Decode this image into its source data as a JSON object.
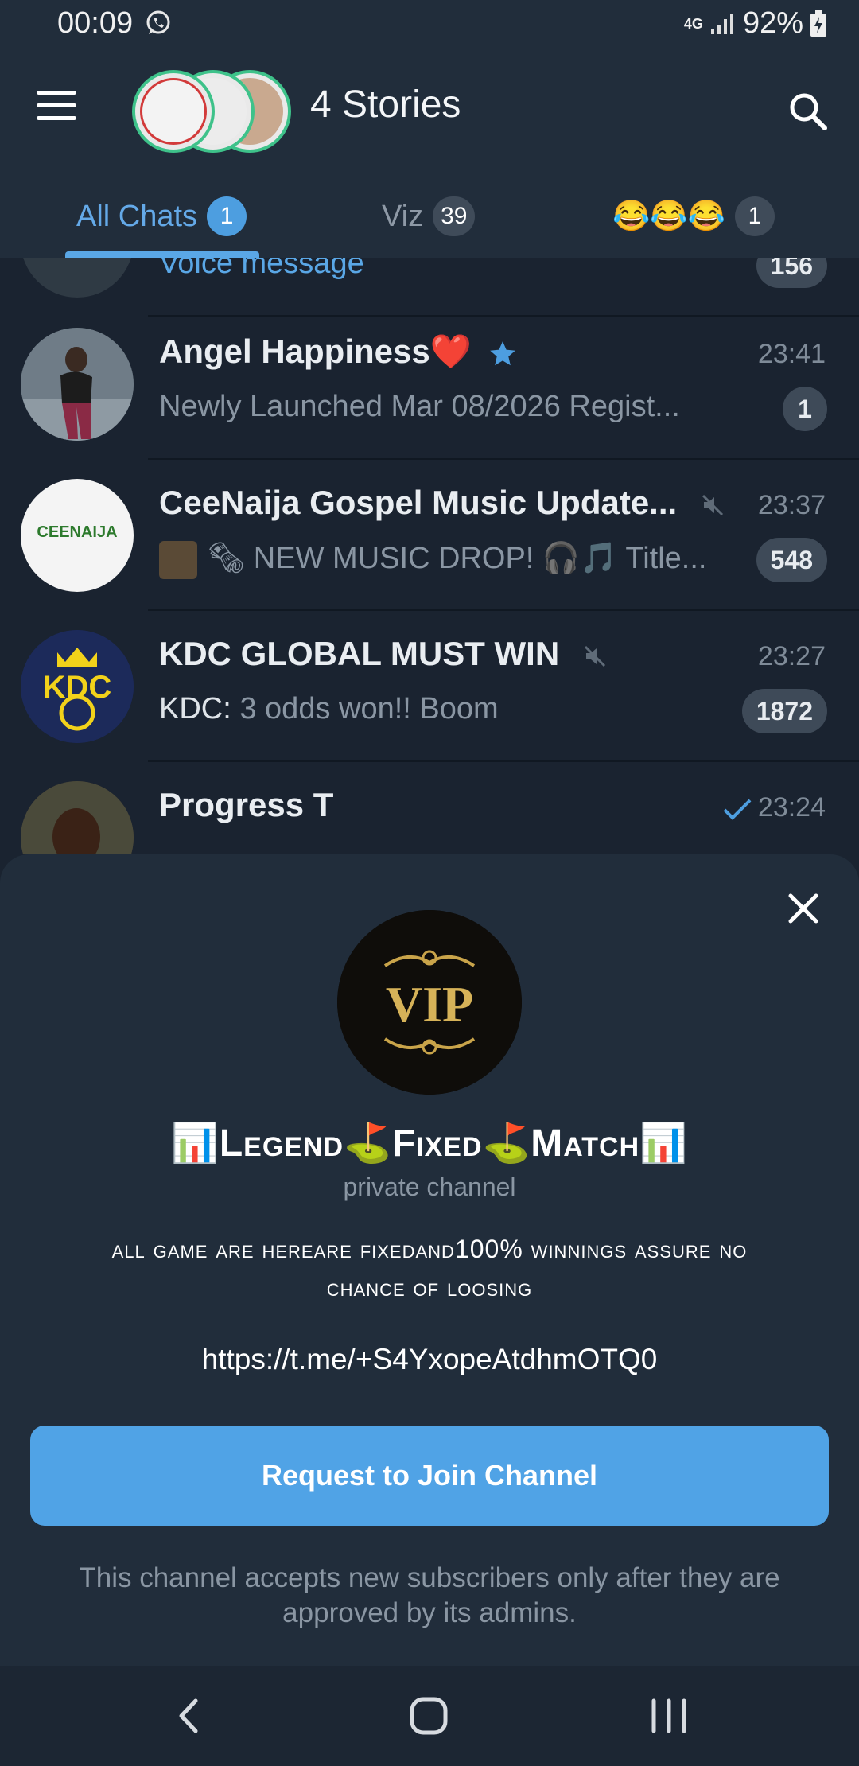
{
  "status_bar": {
    "time": "00:09",
    "network_label": "4G",
    "battery": "92%",
    "icons": [
      "whatsapp-icon",
      "signal-icon",
      "battery-charging-icon"
    ]
  },
  "header": {
    "title": "4 Stories",
    "menu_icon": "menu-icon",
    "search_icon": "search-icon"
  },
  "tabs": [
    {
      "label": "All Chats",
      "badge": "1",
      "active": true
    },
    {
      "label": "Viz",
      "badge": "39",
      "active": false
    },
    {
      "label": "😂😂😂",
      "badge": "1",
      "active": false
    }
  ],
  "chats": [
    {
      "name": "",
      "preview": "Voice message",
      "time": "",
      "count": "156"
    },
    {
      "name": "Angel Happiness❤️",
      "preview": "Newly Launched  Mar 08/2026  Regist...",
      "time": "23:41",
      "count": "1"
    },
    {
      "name": "CeeNaija Gospel Music Update...",
      "preview": "🗞 NEW MUSIC DROP! 🎧🎵 Title...",
      "time": "23:37",
      "count": "548",
      "avatar_text": "CEENAIJA"
    },
    {
      "name": "KDC GLOBAL MUST WIN",
      "preview_sender": "KDC:",
      "preview": "3 odds won!! Boom",
      "time": "23:27",
      "count": "1872",
      "avatar_text": "KDC"
    },
    {
      "name": "Progress T",
      "preview": "",
      "time": "23:24"
    }
  ],
  "sheet": {
    "avatar_text": "VIP",
    "title": "📊Legend⛳Fixed⛳Match📊",
    "subtitle": "private channel",
    "description": "all game are hereare fixedand100% winnings assure no chance of loosing",
    "link": "https://t.me/+S4YxopeAtdhmOTQ0",
    "join_button": "Request to Join Channel",
    "footer": "This channel accepts new subscribers only after they are approved by its admins."
  },
  "colors": {
    "background": "#1a2330",
    "header": "#212d3b",
    "accent": "#50a3e6",
    "badge_grey": "#3e4a58"
  }
}
